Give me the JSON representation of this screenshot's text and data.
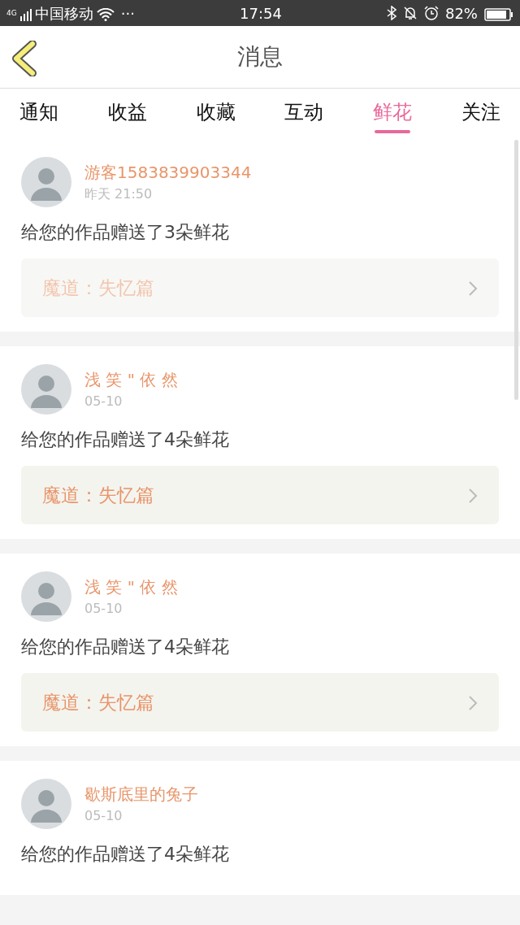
{
  "status_bar": {
    "network": "4G",
    "carrier": "中国移动",
    "more": "···",
    "time": "17:54",
    "battery": "82%"
  },
  "header": {
    "title": "消息"
  },
  "tabs": [
    {
      "label": "通知",
      "selected": false
    },
    {
      "label": "收益",
      "selected": false
    },
    {
      "label": "收藏",
      "selected": false
    },
    {
      "label": "互动",
      "selected": false
    },
    {
      "label": "鲜花",
      "selected": true
    },
    {
      "label": "关注",
      "selected": false
    }
  ],
  "messages": [
    {
      "user": "游客1583839903344",
      "time": "昨天 21:50",
      "text": "给您的作品赠送了3朵鲜花",
      "work": "魔道：失忆篇",
      "dimmed": true
    },
    {
      "user": "浅 笑 \" 依 然",
      "time": "05-10",
      "text": "给您的作品赠送了4朵鲜花",
      "work": "魔道：失忆篇",
      "dimmed": false
    },
    {
      "user": "浅 笑 \" 依 然",
      "time": "05-10",
      "text": "给您的作品赠送了4朵鲜花",
      "work": "魔道：失忆篇",
      "dimmed": false
    },
    {
      "user": "歇斯底里的兔子",
      "time": "05-10",
      "text": "给您的作品赠送了4朵鲜花"
    }
  ]
}
